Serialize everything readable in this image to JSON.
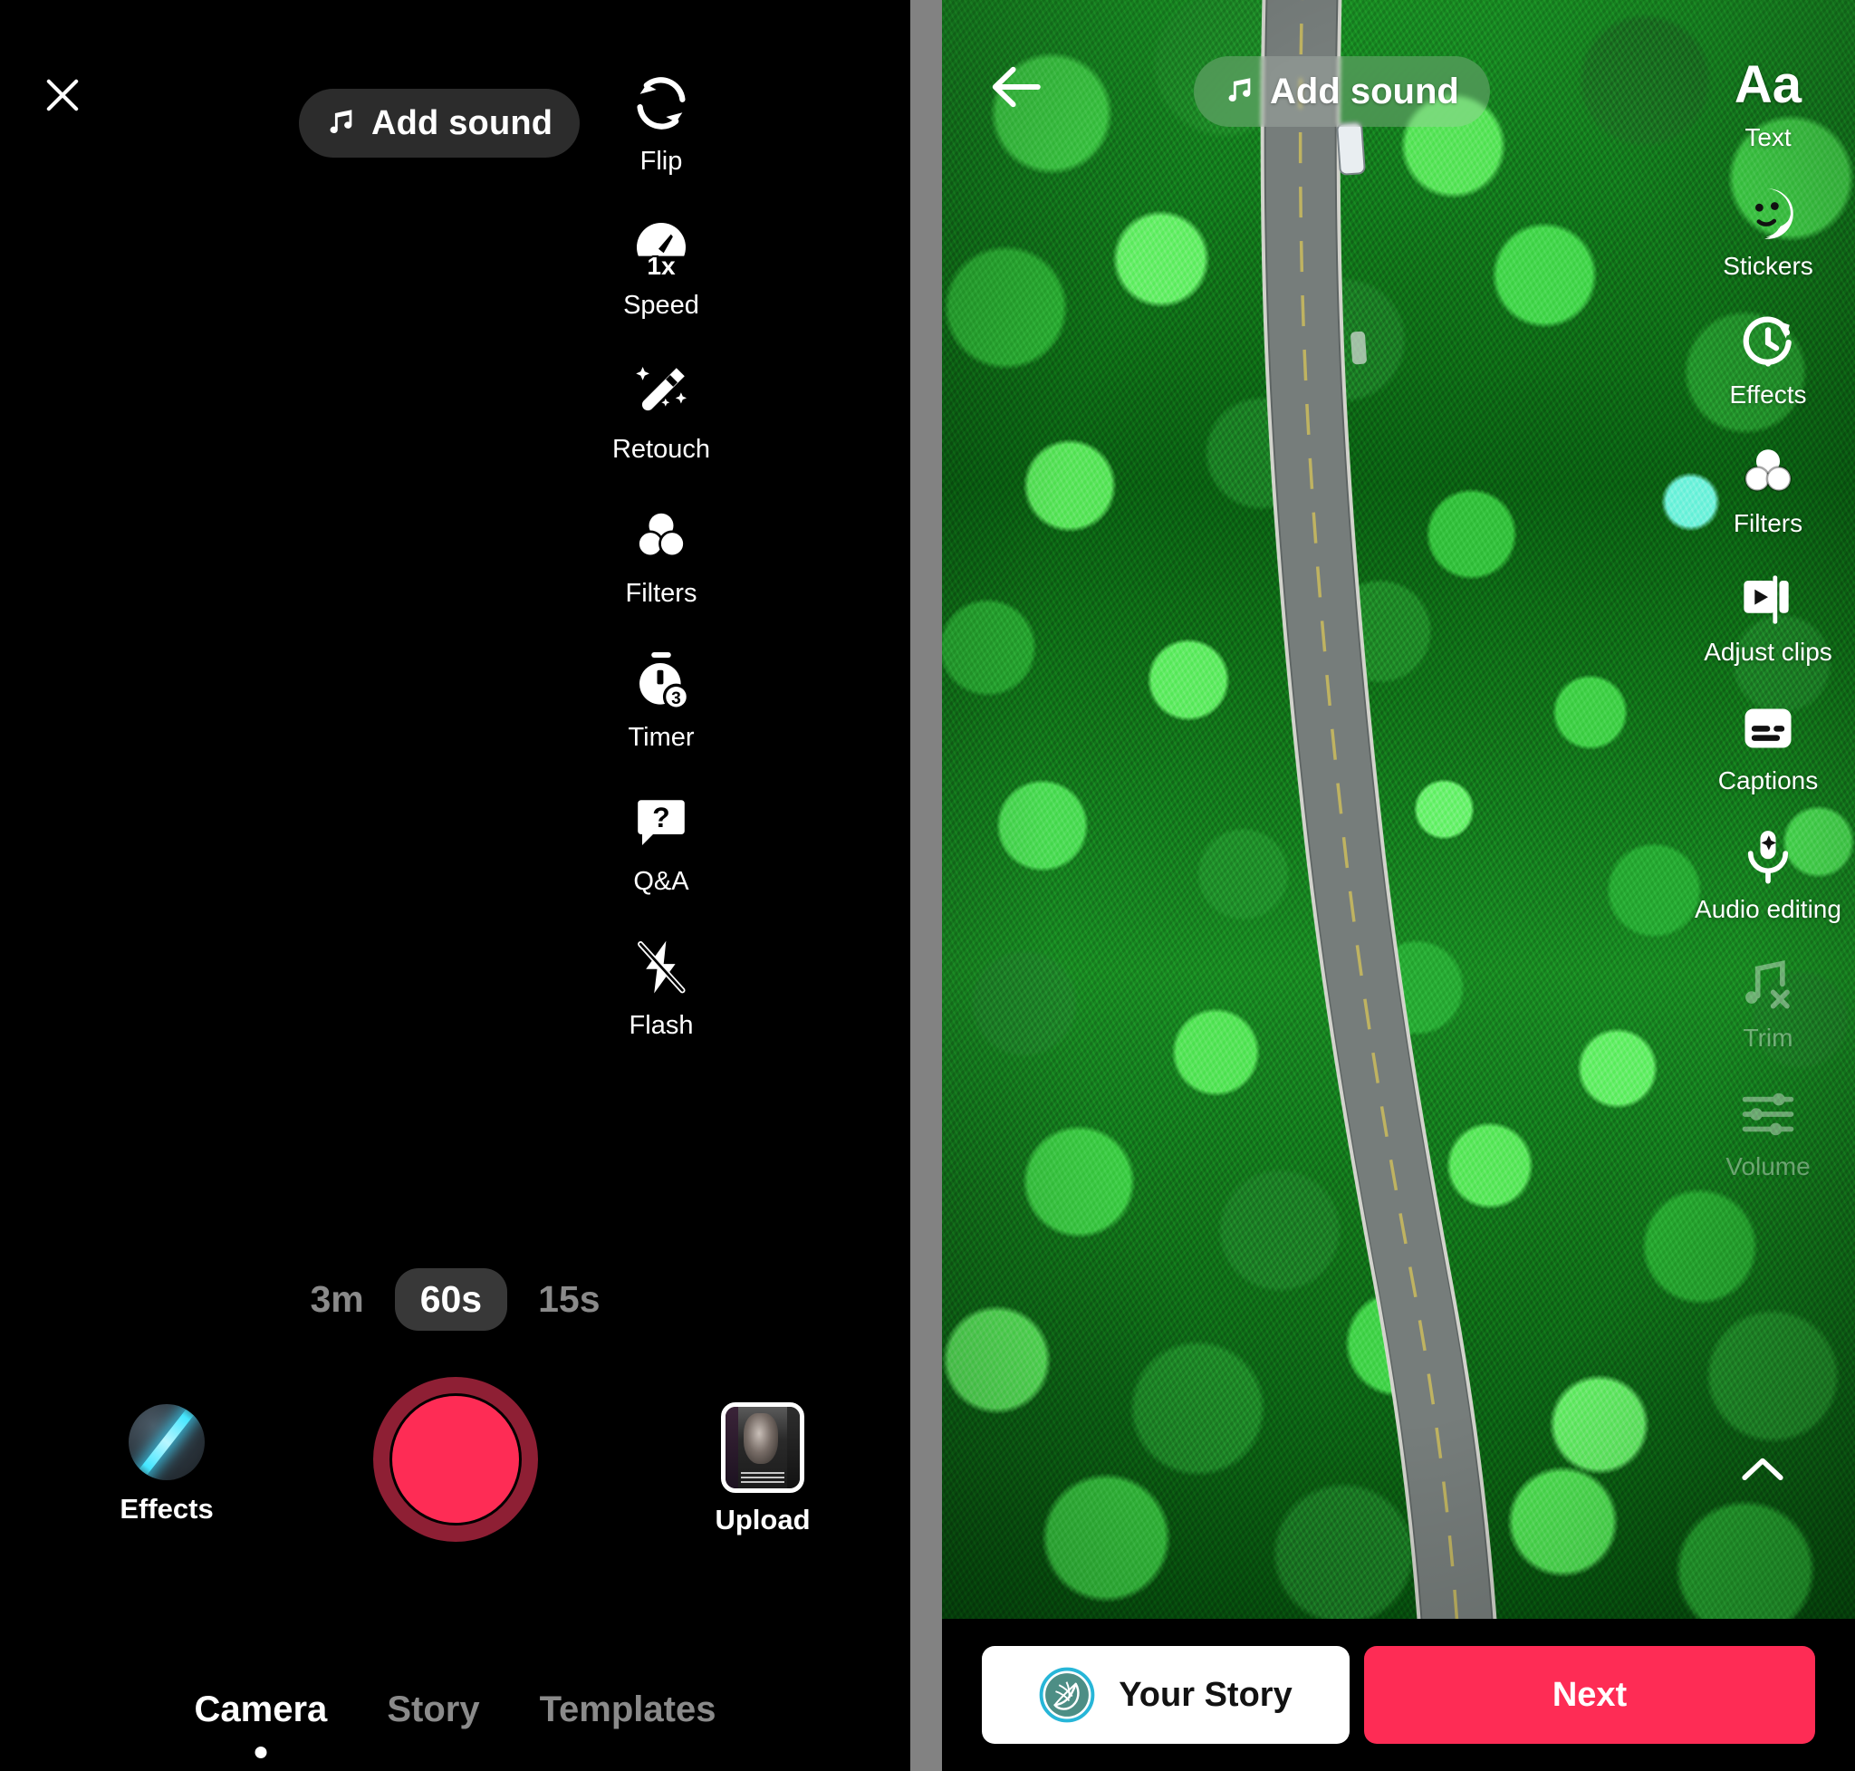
{
  "left_panel": {
    "close_label": "Close",
    "close_icon": "close-icon",
    "add_sound": {
      "label": "Add sound",
      "icon": "music-note-icon"
    },
    "tools": [
      {
        "label": "Flip",
        "icon": "flip-camera-icon"
      },
      {
        "label": "Speed",
        "icon": "speed-1x-icon",
        "value": "1x"
      },
      {
        "label": "Retouch",
        "icon": "magic-wand-icon"
      },
      {
        "label": "Filters",
        "icon": "filters-circles-icon"
      },
      {
        "label": "Timer",
        "icon": "timer-3s-icon",
        "value": "3"
      },
      {
        "label": "Q&A",
        "icon": "question-bubble-icon"
      },
      {
        "label": "Flash",
        "icon": "flash-off-icon"
      }
    ],
    "durations": [
      {
        "label": "3m",
        "selected": false
      },
      {
        "label": "60s",
        "selected": true
      },
      {
        "label": "15s",
        "selected": false
      }
    ],
    "effects_button": {
      "label": "Effects",
      "icon": "effects-orb-icon"
    },
    "record_button": {
      "label": "Record",
      "icon": "shutter-icon",
      "color": "#fe2c55",
      "ring_color": "#8e1f34"
    },
    "upload_button": {
      "label": "Upload",
      "icon": "upload-thumbnail-icon"
    },
    "tabs": [
      {
        "label": "Camera",
        "active": true
      },
      {
        "label": "Story",
        "active": false
      },
      {
        "label": "Templates",
        "active": false
      }
    ]
  },
  "right_panel": {
    "back_label": "Back",
    "back_icon": "arrow-left-icon",
    "add_sound": {
      "label": "Add sound",
      "icon": "music-note-icon"
    },
    "tools": [
      {
        "label": "Text",
        "icon": "text-aa-icon",
        "glyph": "Aa",
        "dimmed": false
      },
      {
        "label": "Stickers",
        "icon": "sticker-face-icon",
        "dimmed": false
      },
      {
        "label": "Effects",
        "icon": "effects-clock-icon",
        "dimmed": false
      },
      {
        "label": "Filters",
        "icon": "filters-circles-icon",
        "dimmed": false
      },
      {
        "label": "Adjust clips",
        "icon": "adjust-clips-icon",
        "dimmed": false
      },
      {
        "label": "Captions",
        "icon": "captions-icon",
        "dimmed": false
      },
      {
        "label": "Audio editing",
        "icon": "microphone-sparkle-icon",
        "dimmed": false
      },
      {
        "label": "Trim",
        "icon": "trim-music-scissors-icon",
        "dimmed": true
      },
      {
        "label": "Volume",
        "icon": "volume-sliders-icon",
        "dimmed": true
      }
    ],
    "collapse_icon": "chevron-up-icon",
    "actions": {
      "your_story": {
        "label": "Your Story",
        "icon": "story-leaf-icon",
        "bg": "#ffffff",
        "fg": "#121212"
      },
      "next": {
        "label": "Next",
        "bg": "#fe2c55",
        "fg": "#ffffff"
      }
    },
    "preview": {
      "description": "Aerial drone view of a forest with a winding two-lane road and cars"
    }
  }
}
